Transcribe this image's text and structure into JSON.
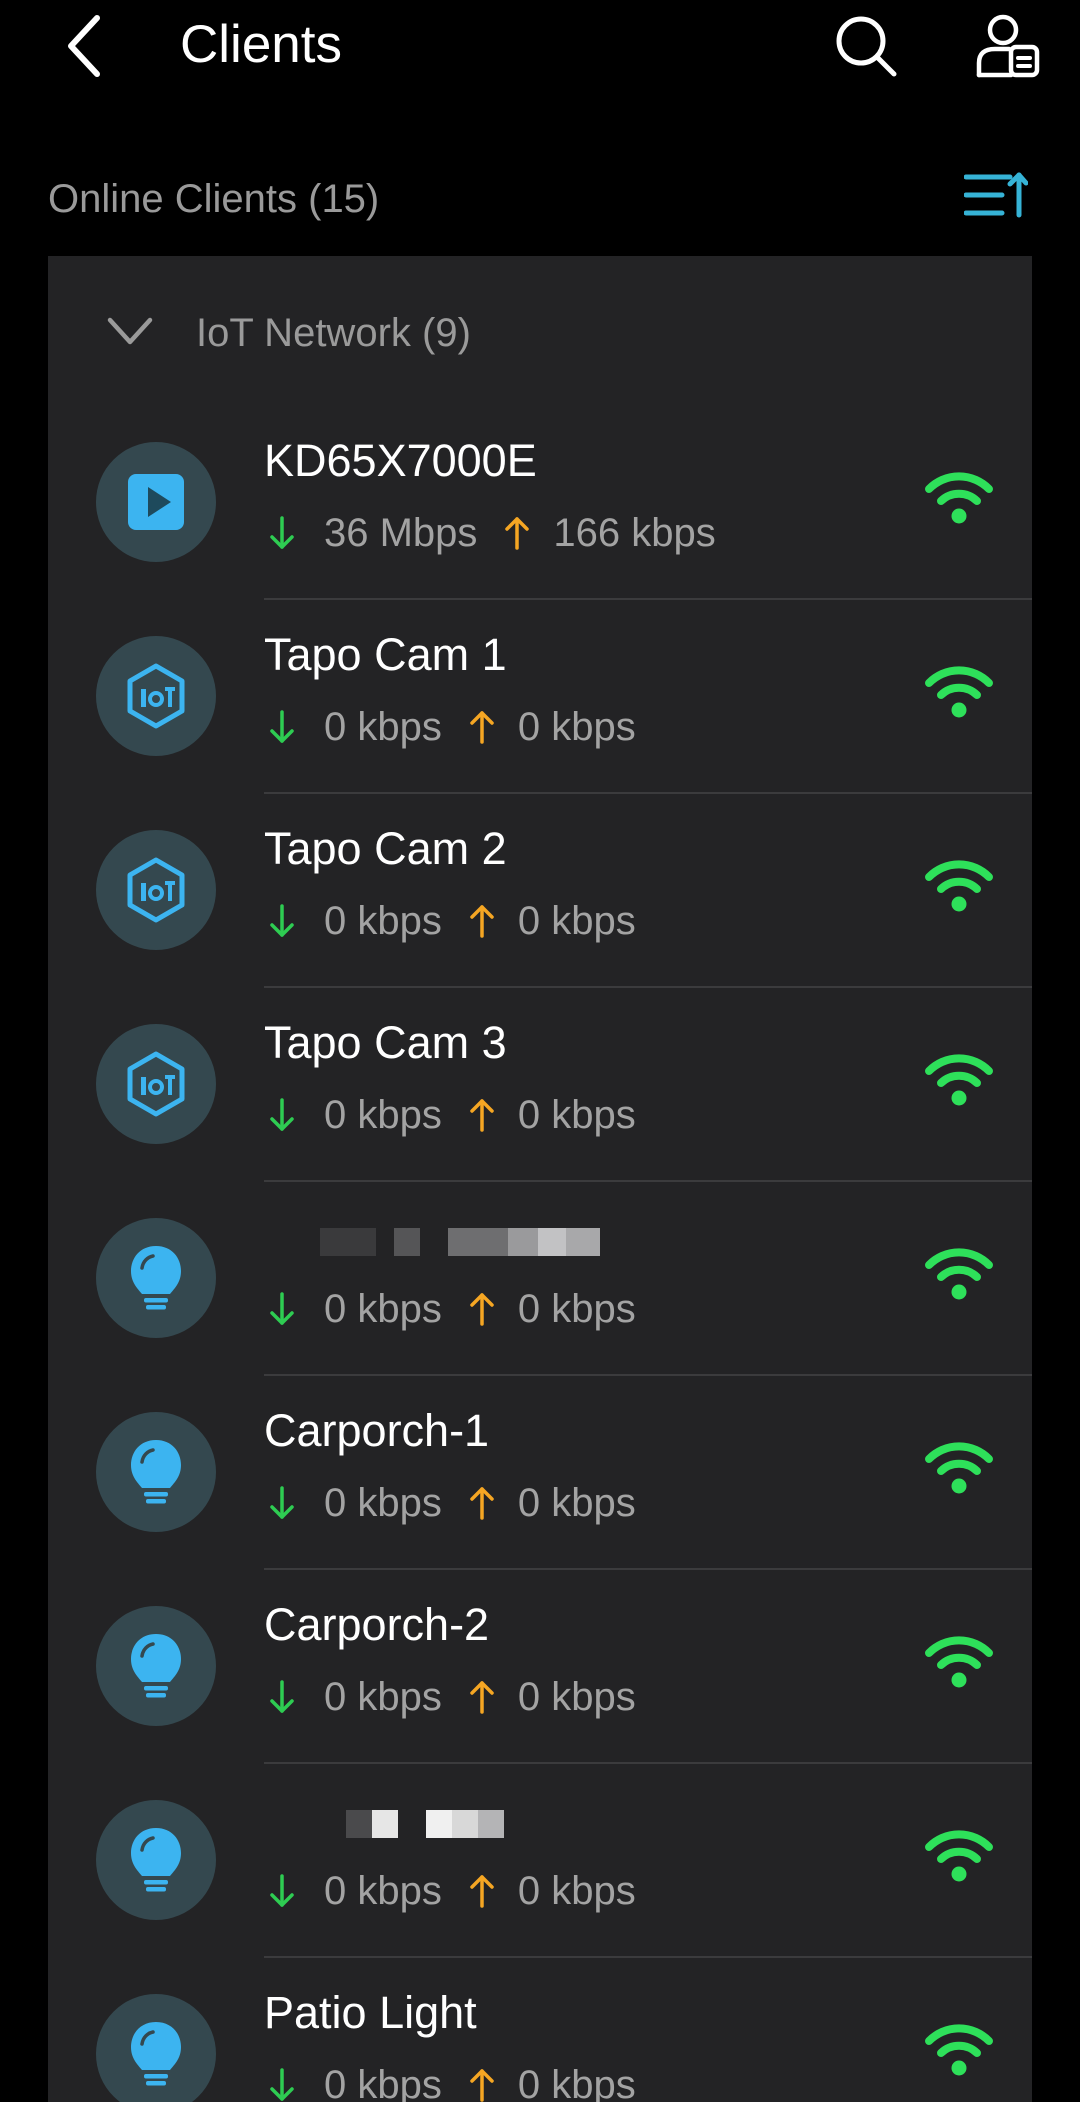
{
  "header": {
    "title": "Clients",
    "back_icon": "chevron-left-icon",
    "search_icon": "search-icon",
    "profile_icon": "user-list-icon"
  },
  "section": {
    "label": "Online Clients (15)",
    "sort_icon": "sort-icon"
  },
  "group": {
    "label": "IoT Network (9)",
    "expanded": true
  },
  "colors": {
    "background": "#000000",
    "card": "#232325",
    "download_arrow": "#2ecc52",
    "upload_arrow": "#f5a623",
    "wifi": "#2ee05a",
    "accent": "#36b3d6",
    "icon_blue": "#3cb4f0"
  },
  "clients": [
    {
      "name": "KD65X7000E",
      "icon": "media-player-icon",
      "download": "36 Mbps",
      "upload": "166 kbps",
      "signal": "wifi-strong-icon"
    },
    {
      "name": "Tapo Cam 1",
      "icon": "iot-camera-icon",
      "download": "0 kbps",
      "upload": "0 kbps",
      "signal": "wifi-strong-icon"
    },
    {
      "name": "Tapo Cam 2",
      "icon": "iot-camera-icon",
      "download": "0 kbps",
      "upload": "0 kbps",
      "signal": "wifi-strong-icon"
    },
    {
      "name": "Tapo Cam 3",
      "icon": "iot-camera-icon",
      "download": "0 kbps",
      "upload": "0 kbps",
      "signal": "wifi-strong-icon"
    },
    {
      "name": "",
      "redacted": true,
      "icon": "light-bulb-icon",
      "download": "0 kbps",
      "upload": "0 kbps",
      "signal": "wifi-strong-icon"
    },
    {
      "name": "Carporch-1",
      "icon": "light-bulb-icon",
      "download": "0 kbps",
      "upload": "0 kbps",
      "signal": "wifi-strong-icon"
    },
    {
      "name": "Carporch-2",
      "icon": "light-bulb-icon",
      "download": "0 kbps",
      "upload": "0 kbps",
      "signal": "wifi-strong-icon"
    },
    {
      "name": "",
      "redacted": true,
      "icon": "light-bulb-icon",
      "download": "0 kbps",
      "upload": "0 kbps",
      "signal": "wifi-strong-icon"
    },
    {
      "name": "Patio Light",
      "icon": "light-bulb-icon",
      "download": "0 kbps",
      "upload": "0 kbps",
      "signal": "wifi-strong-icon"
    }
  ]
}
